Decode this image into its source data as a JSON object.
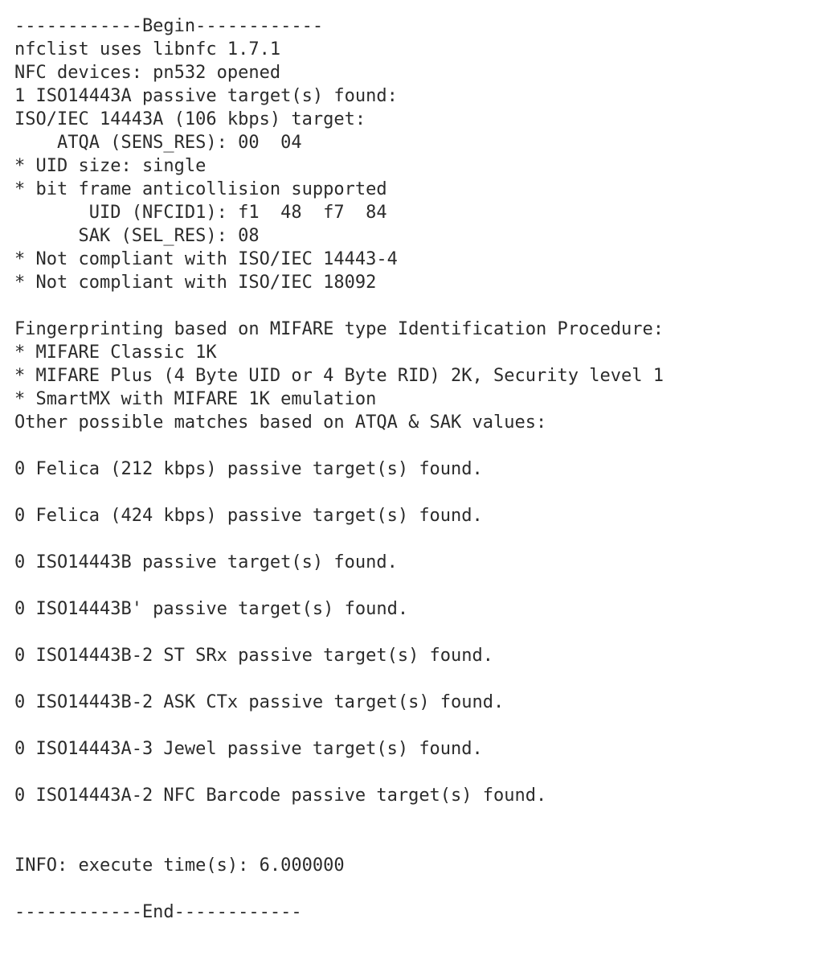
{
  "begin_rule": "------------Begin------------",
  "libnfc_line": "nfclist uses libnfc 1.7.1",
  "device_line": "NFC devices: pn532 opened",
  "found_header": "1 ISO14443A passive target(s) found:",
  "target_header": "ISO/IEC 14443A (106 kbps) target:",
  "atqa_line": "    ATQA (SENS_RES): 00  04",
  "uid_size_line": "* UID size: single",
  "bitframe_line": "* bit frame anticollision supported",
  "uid_line": "       UID (NFCID1): f1  48  f7  84",
  "sak_line": "      SAK (SEL_RES): 08",
  "noncompliant1": "* Not compliant with ISO/IEC 14443-4",
  "noncompliant2": "* Not compliant with ISO/IEC 18092",
  "fingerprint_header": "Fingerprinting based on MIFARE type Identification Procedure:",
  "fp1": "* MIFARE Classic 1K",
  "fp2": "* MIFARE Plus (4 Byte UID or 4 Byte RID) 2K, Security level 1",
  "fp3": "* SmartMX with MIFARE 1K emulation",
  "other_header": "Other possible matches based on ATQA & SAK values:",
  "r0": "0 Felica (212 kbps) passive target(s) found.",
  "r1": "0 Felica (424 kbps) passive target(s) found.",
  "r2": "0 ISO14443B passive target(s) found.",
  "r3": "0 ISO14443B' passive target(s) found.",
  "r4": "0 ISO14443B-2 ST SRx passive target(s) found.",
  "r5": "0 ISO14443B-2 ASK CTx passive target(s) found.",
  "r6": "0 ISO14443A-3 Jewel passive target(s) found.",
  "r7": "0 ISO14443A-2 NFC Barcode passive target(s) found.",
  "info_line": "INFO: execute time(s): 6.000000",
  "end_rule": "------------End------------"
}
